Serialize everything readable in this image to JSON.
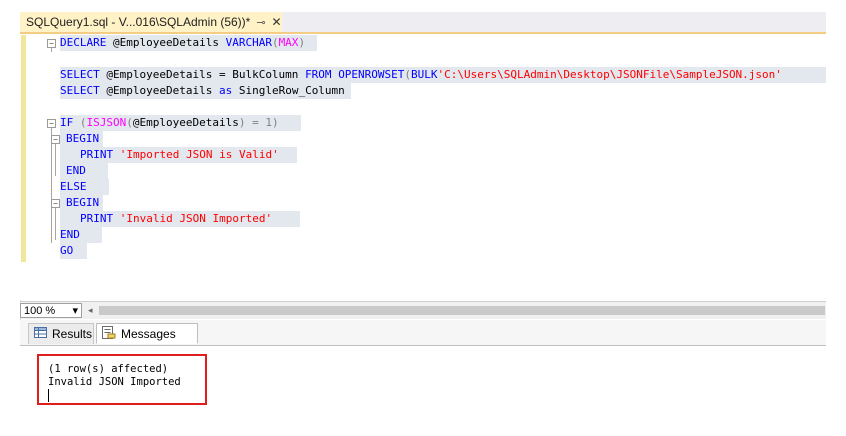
{
  "document_tab": {
    "title": "SQLQuery1.sql - V...016\\SQLAdmin (56))*",
    "pin_icon": "pin-icon",
    "close_icon": "close-icon"
  },
  "code": {
    "l1_kw1": "DECLARE",
    "l1_rest": " @EmployeeDetails ",
    "l1_kw2": "VARCHAR",
    "l1_p1": "(",
    "l1_fn": "MAX",
    "l1_p2": ")",
    "l3_kw1": "SELECT",
    "l3_mid": " @EmployeeDetails = BulkColumn ",
    "l3_kw2": "FROM",
    "l3_sp": " ",
    "l3_kw3": "OPENROWSET",
    "l3_p": "(",
    "l3_kw4": "BULK",
    "l3_str": "'C:\\Users\\SQLAdmin\\Desktop\\JSONFile\\SampleJSON.json'",
    "l4_kw1": "SELECT",
    "l4_mid": " @EmployeeDetails ",
    "l4_kw2": "as",
    "l4_rest": " SingleRow_Column",
    "l6_kw1": "IF",
    "l6_p1": " (",
    "l6_fn": "ISJSON",
    "l6_p2": "(",
    "l6_var": "@EmployeeDetails",
    "l6_p3": ") = 1)",
    "l7_kw": "BEGIN",
    "l8_kw": "PRINT",
    "l8_str": "'Imported JSON is Valid'",
    "l9_kw": "END",
    "l10_kw": "ELSE",
    "l11_kw": "BEGIN",
    "l12_kw": "PRINT",
    "l12_str": "'Invalid JSON Imported'",
    "l13_kw": "END",
    "l14_kw": "GO"
  },
  "status": {
    "zoom": "100 %",
    "zoom_arrow": "▾",
    "scroll_left": "◂"
  },
  "results_tabs": {
    "results_label": "Results",
    "messages_label": "Messages",
    "results_icon": "grid-icon",
    "messages_icon": "messages-icon"
  },
  "messages": {
    "line1": "(1 row(s) affected)",
    "line2": "Invalid JSON Imported"
  },
  "colors": {
    "keyword": "#0000ff",
    "string": "#ff0000",
    "function": "#ff00ff",
    "highlight_box": "#e11e1e",
    "tab_background": "#fff2c6"
  }
}
